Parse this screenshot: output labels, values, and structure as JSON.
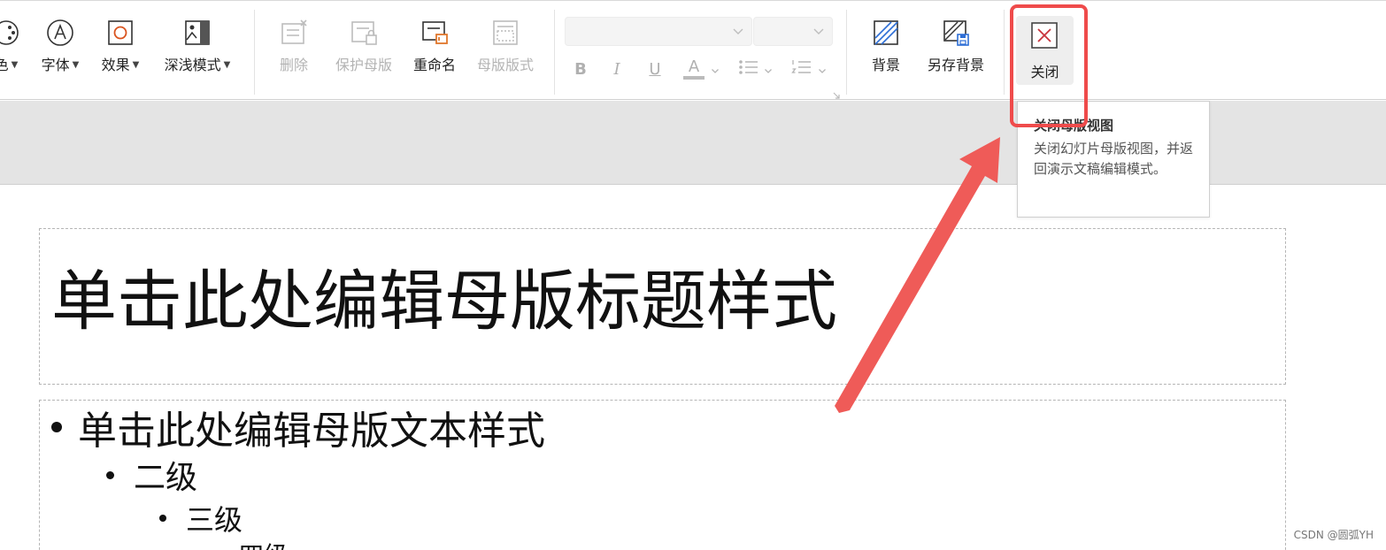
{
  "ribbon": {
    "partial_label": "色",
    "font_label": "字体",
    "effects_label": "效果",
    "mode_label": "深浅模式",
    "delete_label": "删除",
    "protect_label": "保护母版",
    "rename_label": "重命名",
    "layout_label": "母版版式",
    "bold_label": "B",
    "italic_label": "I",
    "underline_label": "U",
    "font_color_label": "A",
    "background_label": "背景",
    "save_background_label": "另存背景",
    "close_label": "关闭"
  },
  "tooltip": {
    "title": "关闭母版视图",
    "description": "关闭幻灯片母版视图，并返回演示文稿编辑模式。"
  },
  "slide": {
    "title": "单击此处编辑母版标题样式",
    "level1": "单击此处编辑母版文本样式",
    "level2": "二级",
    "level3": "三级",
    "level4": "四级"
  },
  "watermark": "CSDN @圆弧YH",
  "colors": {
    "highlight": "#ef4b4b",
    "arrow": "#ef5b58",
    "close_icon": "#c8343c",
    "ribbon_bg": "#ffffff",
    "band_bg": "#e4e4e4"
  }
}
